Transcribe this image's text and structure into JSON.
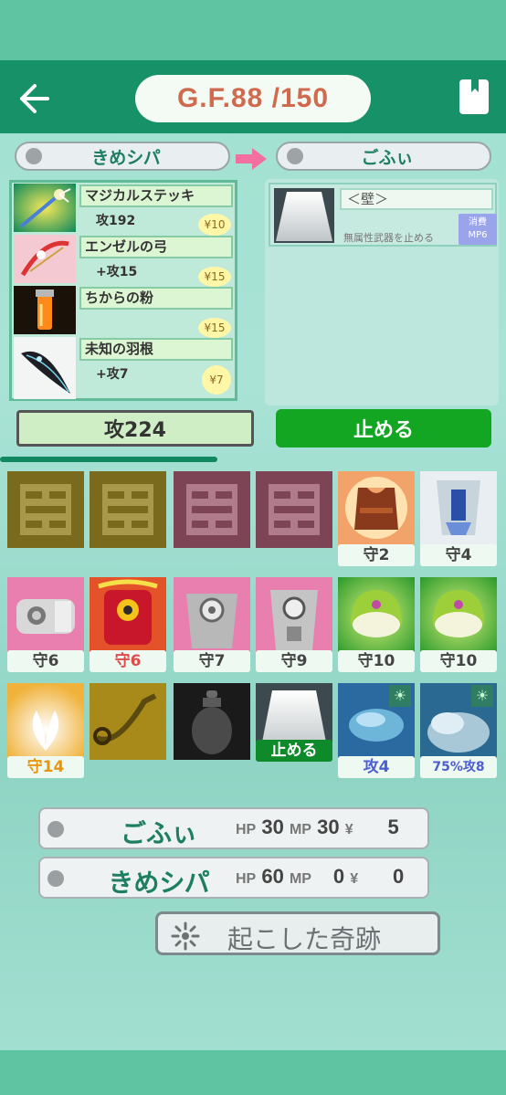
{
  "header": {
    "gf_text": "G.F.88 /150"
  },
  "players": {
    "left_name": "きめシパ",
    "right_name": "ごふぃ"
  },
  "items": [
    {
      "name": "マジカルステッキ",
      "stat": "攻192",
      "price": "¥10"
    },
    {
      "name": "エンゼルの弓",
      "stat": "+攻15",
      "price": "¥15"
    },
    {
      "name": "ちからの粉",
      "stat": "",
      "price": "¥15"
    },
    {
      "name": "未知の羽根",
      "stat": "+攻7",
      "price": "¥7"
    }
  ],
  "spell": {
    "name": "＜壁＞",
    "desc": "無属性武器を止める",
    "cost_label": "消費",
    "cost_value": "MP6"
  },
  "attack_total": "攻224",
  "stop_button": "止める",
  "progress": 0.43,
  "grid": [
    {
      "label": "",
      "icon": "empty-slot-icon"
    },
    {
      "label": "",
      "icon": "empty-slot-icon"
    },
    {
      "label": "",
      "icon": "empty-slot-icon"
    },
    {
      "label": "",
      "icon": "empty-slot-icon"
    },
    {
      "label": "守2",
      "icon": "leather-vest-icon"
    },
    {
      "label": "守4",
      "icon": "blue-armor-icon"
    },
    {
      "label": "守6",
      "icon": "gauntlet-icon"
    },
    {
      "label": "守6",
      "icon": "red-armor-icon"
    },
    {
      "label": "守7",
      "icon": "silver-armor-icon"
    },
    {
      "label": "守9",
      "icon": "silver-plate-icon"
    },
    {
      "label": "守10",
      "icon": "green-helmet-icon"
    },
    {
      "label": "守10",
      "icon": "green-helmet-icon"
    },
    {
      "label": "守14",
      "icon": "light-burst-icon"
    },
    {
      "label": "",
      "icon": "horn-icon"
    },
    {
      "label": "",
      "icon": "urn-icon"
    },
    {
      "label": "止める",
      "icon": "wall-icon"
    },
    {
      "label": "攻4",
      "icon": "blue-wind-icon"
    },
    {
      "label": "75%攻8",
      "icon": "storm-cloud-icon"
    }
  ],
  "label_colors": {
    "default": "#444444",
    "red": "#e04a4a",
    "orange": "#e8960c",
    "blue": "#4b5fd0",
    "stop": "#ffffff"
  },
  "status": [
    {
      "name": "ごふぃ",
      "hp_label": "HP",
      "hp": "30",
      "mp_label": "MP",
      "mp": "30",
      "yen_label": "¥",
      "yen": "5"
    },
    {
      "name": "きめシパ",
      "hp_label": "HP",
      "hp": "60",
      "mp_label": "MP",
      "mp": "0",
      "yen_label": "¥",
      "yen": "0"
    }
  ],
  "miracle_button": "起こした奇跡"
}
